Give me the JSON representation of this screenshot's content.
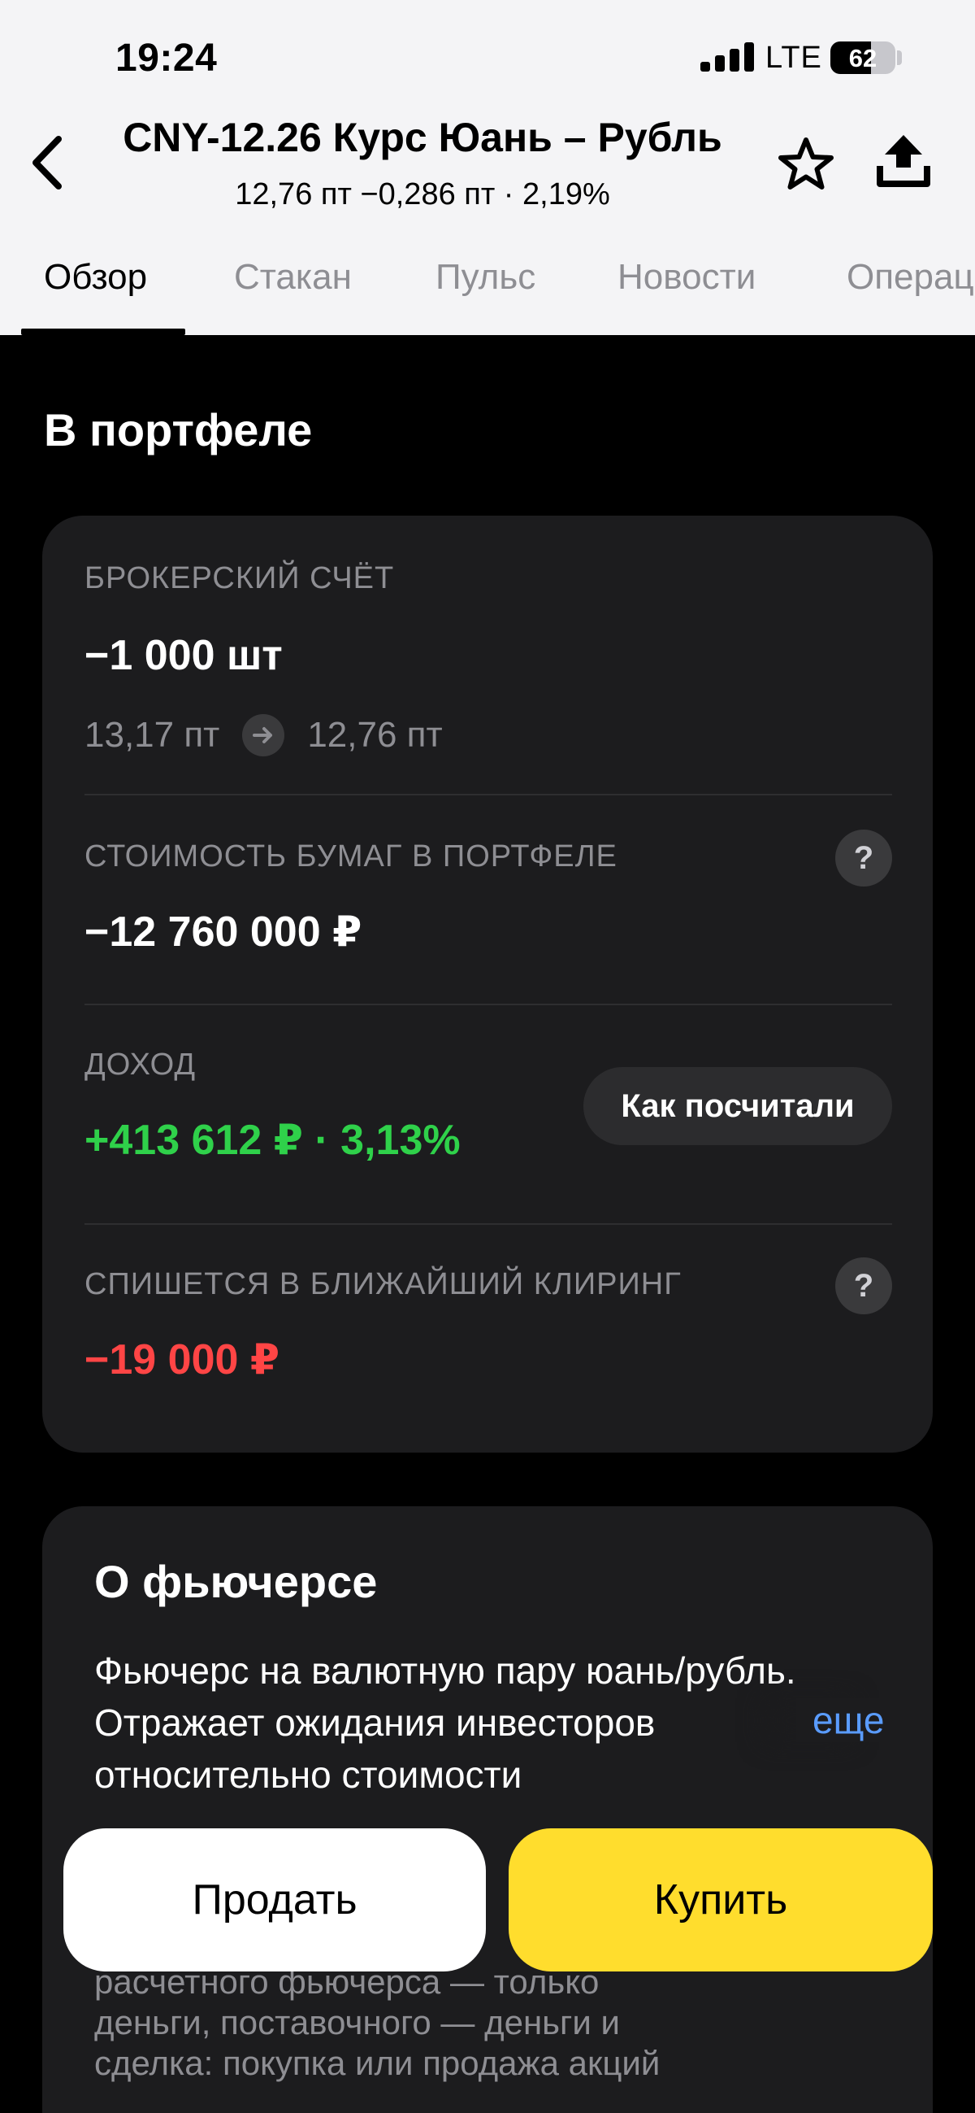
{
  "status_bar": {
    "time": "19:24",
    "network": "LTE",
    "battery": 62
  },
  "header": {
    "title": "CNY-12.26 Курс Юань – Рубль",
    "subtitle": "12,76 пт   −0,286 пт · 2,19%",
    "icons": {
      "back": "chevron-left-icon",
      "favorite": "star-icon",
      "share": "share-icon"
    }
  },
  "tabs": [
    {
      "label": "Обзор",
      "active": true
    },
    {
      "label": "Стакан",
      "active": false
    },
    {
      "label": "Пульс",
      "active": false
    },
    {
      "label": "Новости",
      "active": false
    },
    {
      "label": "Операции",
      "active": false
    }
  ],
  "portfolio": {
    "section_title": "В портфеле",
    "account_label": "БРОКЕРСКИЙ СЧЁТ",
    "quantity": "−1 000 шт",
    "avg_price": "13,17 пт",
    "current_price": "12,76 пт",
    "value_label": "СТОИМОСТЬ БУМАГ В ПОРТФЕЛЕ",
    "value": "−12 760 000 ₽",
    "income_label": "ДОХОД",
    "income": "+413 612 ₽ · 3,13%",
    "how_calculated": "Как посчитали",
    "clearing_label": "СПИШЕТСЯ В БЛИЖАЙШИЙ КЛИРИНГ",
    "clearing_value": "−19 000 ₽",
    "help_symbol": "?"
  },
  "about": {
    "title": "О фьючерсе",
    "text": "Фьючерс на валютную пару юань/рубль. Отражает ожидания инвесторов относительно стоимости",
    "more": "еще",
    "text_hidden": "расчетного фьючерса — только деньги, поставочного — деньги и сделка: покупка или продажа акций"
  },
  "actions": {
    "sell": "Продать",
    "buy": "Купить"
  },
  "colors": {
    "accent_yellow": "#ffdd2d",
    "positive": "#2fd14a",
    "negative": "#ff4545",
    "link": "#5a9cff",
    "card": "#1c1c1e"
  }
}
